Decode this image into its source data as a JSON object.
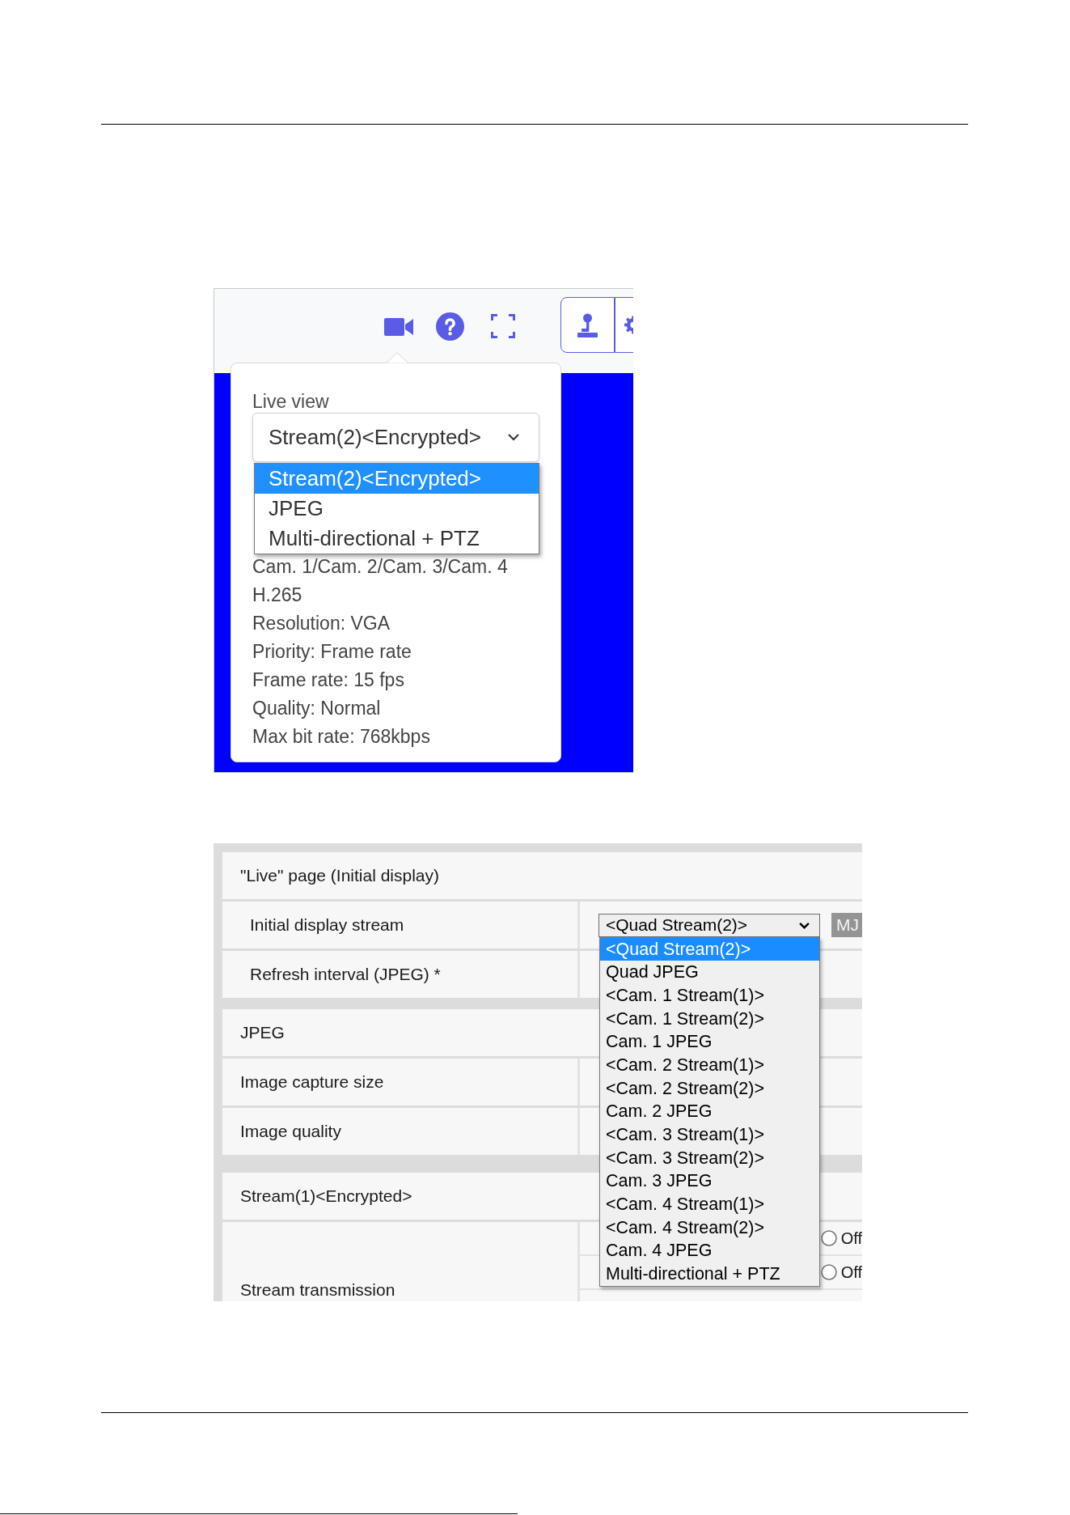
{
  "live_view_screenshot": {
    "popup": {
      "label": "Live view",
      "stream_select": {
        "value": "Stream(2)<Encrypted>",
        "expanded": true,
        "options": [
          {
            "label": "Stream(2)<Encrypted>",
            "selected": true
          },
          {
            "label": "JPEG",
            "selected": false
          },
          {
            "label": "Multi-directional + PTZ",
            "selected": false
          }
        ]
      },
      "details": [
        "Cam. 1/Cam. 2/Cam. 3/Cam. 4",
        "H.265",
        "Resolution: VGA",
        "Priority: Frame rate",
        "Frame rate: 15 fps",
        "Quality: Normal",
        "Max bit rate: 768kbps"
      ]
    }
  },
  "settings_screenshot": {
    "sections": [
      {
        "title": "\"Live\" page (Initial display)",
        "rows": [
          {
            "label": "Initial display stream",
            "indented": true,
            "kind": "select",
            "select": {
              "value": "<Quad Stream(2)>",
              "expanded": true,
              "options": [
                {
                  "label": "<Quad Stream(2)>",
                  "selected": true
                },
                {
                  "label": "Quad JPEG",
                  "selected": false
                },
                {
                  "label": "<Cam. 1 Stream(1)>",
                  "selected": false
                },
                {
                  "label": "<Cam. 1 Stream(2)>",
                  "selected": false
                },
                {
                  "label": "Cam. 1 JPEG",
                  "selected": false
                },
                {
                  "label": "<Cam. 2 Stream(1)>",
                  "selected": false
                },
                {
                  "label": "<Cam. 2 Stream(2)>",
                  "selected": false
                },
                {
                  "label": "Cam. 2 JPEG",
                  "selected": false
                },
                {
                  "label": "<Cam. 3 Stream(1)>",
                  "selected": false
                },
                {
                  "label": "<Cam. 3 Stream(2)>",
                  "selected": false
                },
                {
                  "label": "Cam. 3 JPEG",
                  "selected": false
                },
                {
                  "label": "<Cam. 4 Stream(1)>",
                  "selected": false
                },
                {
                  "label": "<Cam. 4 Stream(2)>",
                  "selected": false
                },
                {
                  "label": "Cam. 4 JPEG",
                  "selected": false
                },
                {
                  "label": "Multi-directional + PTZ",
                  "selected": false
                }
              ]
            },
            "button": {
              "label": "MJ",
              "disabled": true
            }
          },
          {
            "label": "Refresh interval (JPEG) *",
            "indented": true,
            "kind": "plain"
          }
        ]
      },
      {
        "title": "JPEG",
        "rows": [
          {
            "label": "Image capture size",
            "indented": false,
            "kind": "plain"
          },
          {
            "label": "Image quality",
            "indented": false,
            "kind": "plain"
          }
        ]
      },
      {
        "title": "Stream(1)<Encrypted>",
        "rows": [
          {
            "label": "Stream transmission",
            "indented": false,
            "kind": "radios",
            "radios": [
              {
                "label": "Off",
                "selected": false
              },
              {
                "label": "Off",
                "selected": false
              }
            ]
          }
        ]
      }
    ]
  }
}
